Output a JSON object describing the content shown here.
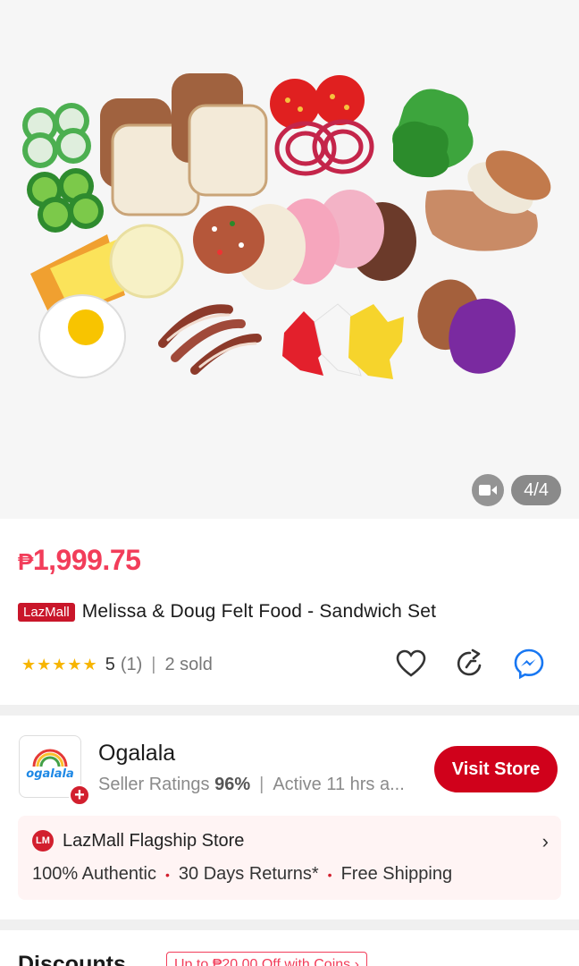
{
  "gallery": {
    "counter": "4/4",
    "video_icon": "video-camera-icon"
  },
  "product": {
    "currency": "₱",
    "price": "1,999.75",
    "badge": "LazMall",
    "title": "Melissa & Doug Felt Food - Sandwich Set",
    "stars": "★★★★★",
    "rating_value": "5",
    "rating_count": "(1)",
    "separator": "|",
    "sold": "2 sold",
    "actions": [
      "heart-icon",
      "share-icon",
      "messenger-icon"
    ]
  },
  "store": {
    "name": "Ogalala",
    "ratings_label": "Seller Ratings",
    "ratings_value": "96%",
    "separator": "|",
    "active": "Active 11 hrs a...",
    "visit_label": "Visit Store",
    "logo_text": "ogalala",
    "flagship": {
      "icon_text": "LM",
      "label": "LazMall Flagship Store",
      "chevron": "›",
      "perks": [
        "100% Authentic",
        "30 Days Returns*",
        "Free Shipping"
      ],
      "perk_dot": "•"
    }
  },
  "discounts": {
    "title": "Discounts",
    "chip": "Up to ₱20.00 Off with Coins ›"
  },
  "colors": {
    "price": "#f23d5a",
    "lazmall_red": "#c9162a",
    "visit_button": "#d0011b",
    "star": "#f7b500"
  }
}
